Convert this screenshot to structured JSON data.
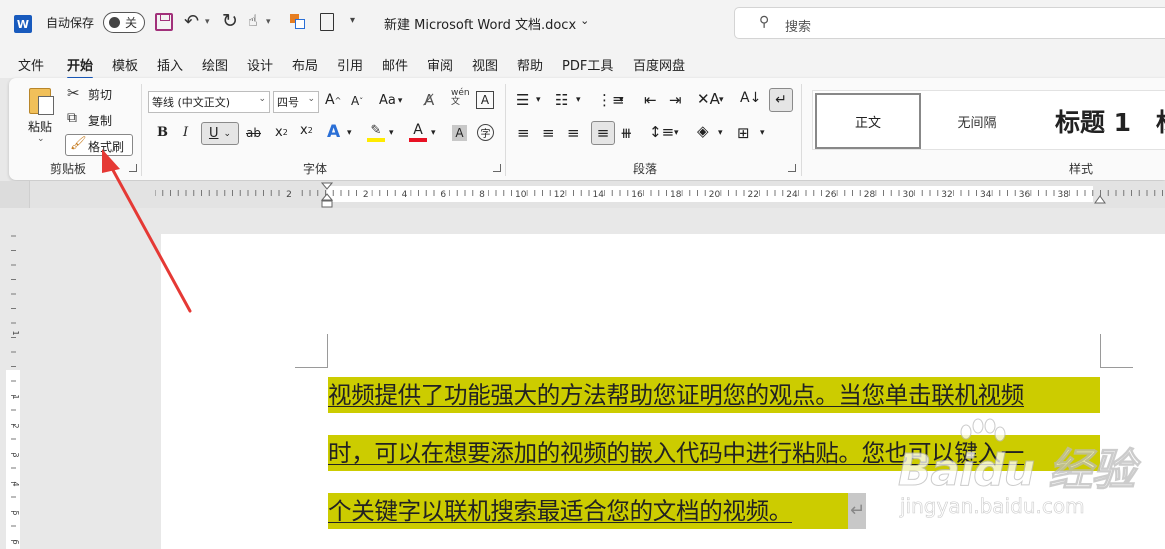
{
  "titlebar": {
    "app_icon": "W",
    "autosave_label": "自动保存",
    "autosave_state": "关",
    "doc_title": "新建 Microsoft Word 文档.docx",
    "doc_title_caret": "⌄",
    "search_placeholder": "搜索"
  },
  "tabs": [
    "文件",
    "开始",
    "模板",
    "插入",
    "绘图",
    "设计",
    "布局",
    "引用",
    "邮件",
    "审阅",
    "视图",
    "帮助",
    "PDF工具",
    "百度网盘"
  ],
  "active_tab": "开始",
  "ribbon": {
    "clipboard": {
      "paste": "粘贴",
      "cut": "剪切",
      "copy": "复制",
      "format_painter": "格式刷",
      "label": "剪贴板"
    },
    "font": {
      "font_name": "等线 (中文正文)",
      "font_size": "四号",
      "grow": "A",
      "shrink": "A",
      "case": "Aa",
      "bold": "B",
      "italic": "I",
      "underline": "U",
      "strike": "ab",
      "subscript": "x",
      "superscript": "x",
      "font_color_letter": "A",
      "char_shade_letter": "A",
      "label": "字体"
    },
    "paragraph": {
      "label": "段落"
    },
    "styles": {
      "items": [
        "正文",
        "无间隔",
        "标题 1",
        "标"
      ],
      "label": "样式"
    }
  },
  "ruler_h_labels": [
    "2",
    "2",
    "4",
    "6",
    "8",
    "10",
    "12",
    "14",
    "16",
    "18",
    "20",
    "22",
    "24",
    "26",
    "28",
    "30",
    "32",
    "34",
    "36",
    "38"
  ],
  "ruler_v_labels": [
    "1",
    "1",
    "2",
    "3",
    "4",
    "5",
    "6"
  ],
  "document": {
    "lines": [
      "视频提供了功能强大的方法帮助您证明您的观点。当您单击联机视频",
      "时，可以在想要添加的视频的嵌入代码中进行粘贴。您也可以键入一",
      "个关键字以联机搜索最适合您的文档的视频。"
    ],
    "return_mark": "↵"
  },
  "watermark": {
    "main": "Baidu 经验",
    "sub": "jingyan.baidu.com"
  },
  "colors": {
    "brand": "#185abd",
    "highlight": "#cccc00",
    "arrow": "#e53935",
    "font_color_bar": "#e81123",
    "highlight_bar": "#ffeb00"
  }
}
